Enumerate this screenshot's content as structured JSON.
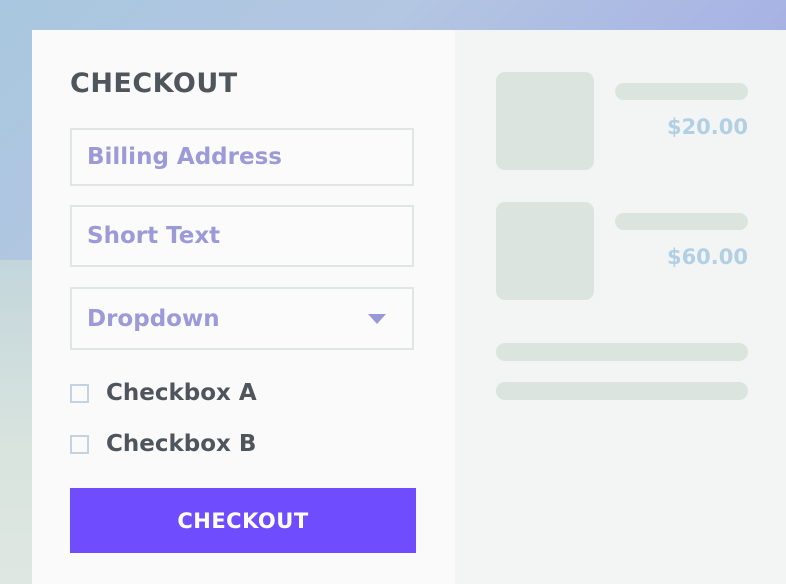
{
  "form": {
    "title": "CHECKOUT",
    "billing_address_placeholder": "Billing Address",
    "short_text_placeholder": "Short Text",
    "dropdown_value": "Dropdown",
    "checkbox_a_label": "Checkbox A",
    "checkbox_b_label": "Checkbox B",
    "checkbox_a_checked": false,
    "checkbox_b_checked": false,
    "submit_label": "CHECKOUT"
  },
  "order_summary": {
    "items": [
      {
        "price": "$20.00"
      },
      {
        "price": "$60.00"
      }
    ]
  },
  "colors": {
    "accent": "#704cff",
    "heading_text": "#4f555c",
    "placeholder_text": "#9c9ad8",
    "price_text": "#b1d0e4",
    "skeleton": "#dbe4df"
  },
  "icons": {
    "dropdown": "caret-down-icon"
  }
}
